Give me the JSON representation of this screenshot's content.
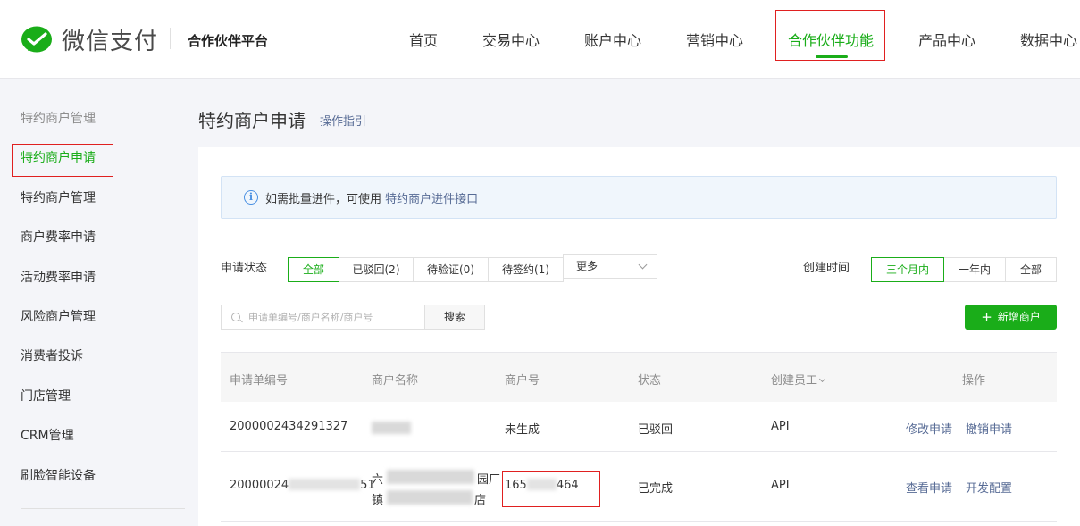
{
  "header": {
    "logo_text": "微信支付",
    "platform": "合作伙伴平台",
    "nav": [
      "首页",
      "交易中心",
      "账户中心",
      "营销中心",
      "合作伙伴功能",
      "产品中心",
      "数据中心"
    ],
    "active_nav": "合作伙伴功能"
  },
  "sidebar": {
    "group_title": "特约商户管理",
    "items": [
      "特约商户申请",
      "特约商户管理",
      "商户费率申请",
      "活动费率申请",
      "风险商户管理",
      "消费者投诉",
      "门店管理",
      "CRM管理",
      "刷脸智能设备"
    ],
    "active": "特约商户申请"
  },
  "page": {
    "title": "特约商户申请",
    "guide_link": "操作指引"
  },
  "notice": {
    "text": "如需批量进件，可使用",
    "link": "特约商户进件接口",
    "icon": "info-icon"
  },
  "filters": {
    "status_label": "申请状态",
    "status_options": [
      "全部",
      "已驳回(2)",
      "待验证(0)",
      "待签约(1)"
    ],
    "status_active": "全部",
    "more_label": "更多",
    "time_label": "创建时间",
    "time_options": [
      "三个月内",
      "一年内",
      "全部"
    ],
    "time_active": "三个月内"
  },
  "search": {
    "placeholder": "申请单编号/商户名称/商户号",
    "value": "",
    "button": "搜索"
  },
  "add_button": "新增商户",
  "table": {
    "headers": [
      "申请单编号",
      "商户名称",
      "商户号",
      "状态",
      "创建员工",
      "操作"
    ],
    "rows": [
      {
        "id": "2000002434291327",
        "name": "",
        "merchant_no": "未生成",
        "status": "已驳回",
        "creator": "API",
        "actions": [
          "修改申请",
          "撤销申请"
        ]
      },
      {
        "id": "20000024",
        "id_tail": "51",
        "name_line1_a": "六",
        "name_line1_b": "园厂",
        "name_line2_a": "镇",
        "name_line2_b": "店",
        "merchant_no_a": "165",
        "merchant_no_b": "464",
        "status": "已完成",
        "creator": "API",
        "actions": [
          "查看申请",
          "开发配置"
        ]
      }
    ]
  },
  "colors": {
    "accent": "#1aad19",
    "link": "#576b95",
    "highlight_box": "#e02020"
  }
}
